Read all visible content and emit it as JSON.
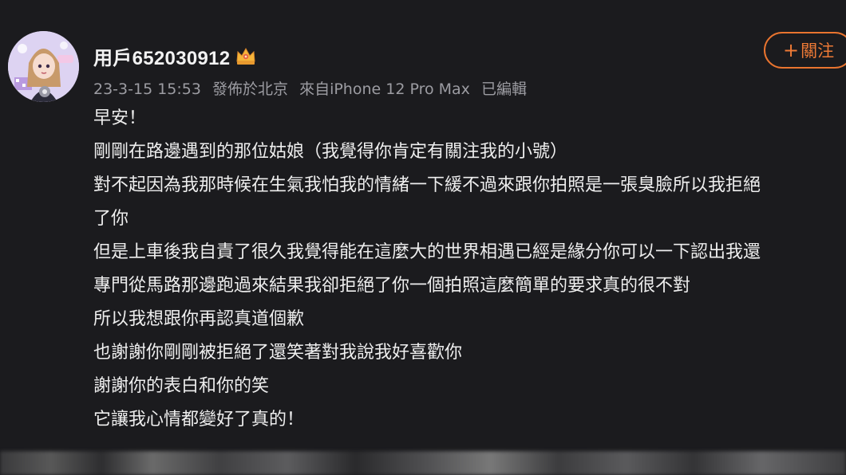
{
  "post": {
    "author": {
      "username": "用戶652030912",
      "avatar_icon": "user-avatar",
      "badge_icon": "vip-crown-icon"
    },
    "meta": {
      "timestamp": "23-3-15 15:53",
      "location": "發佈於北京",
      "device": "來自iPhone 12 Pro Max",
      "edited": "已編輯"
    },
    "follow_button": {
      "plus": "+",
      "label": "關注"
    },
    "content_lines": [
      "早安！",
      "剛剛在路邊遇到的那位姑娘（我覺得你肯定有關注我的小號）",
      "對不起因為我那時候在生氣我怕我的情緒一下緩不過來跟你拍照是一張臭臉所以我拒絕",
      "了你",
      "但是上車後我自責了很久我覺得能在這麼大的世界相遇已經是緣分你可以一下認出我還",
      "專門從馬路那邊跑過來結果我卻拒絕了你一個拍照這麼簡單的要求真的很不對",
      "所以我想跟你再認真道個歉",
      "也謝謝你剛剛被拒絕了還笑著對我說我好喜歡你",
      "謝謝你的表白和你的笑",
      "它讓我心情都變好了真的！"
    ]
  },
  "colors": {
    "background": "#1b1b1e",
    "text": "#eeeeee",
    "meta_text": "#9c9ca2",
    "accent": "#e9742f"
  }
}
